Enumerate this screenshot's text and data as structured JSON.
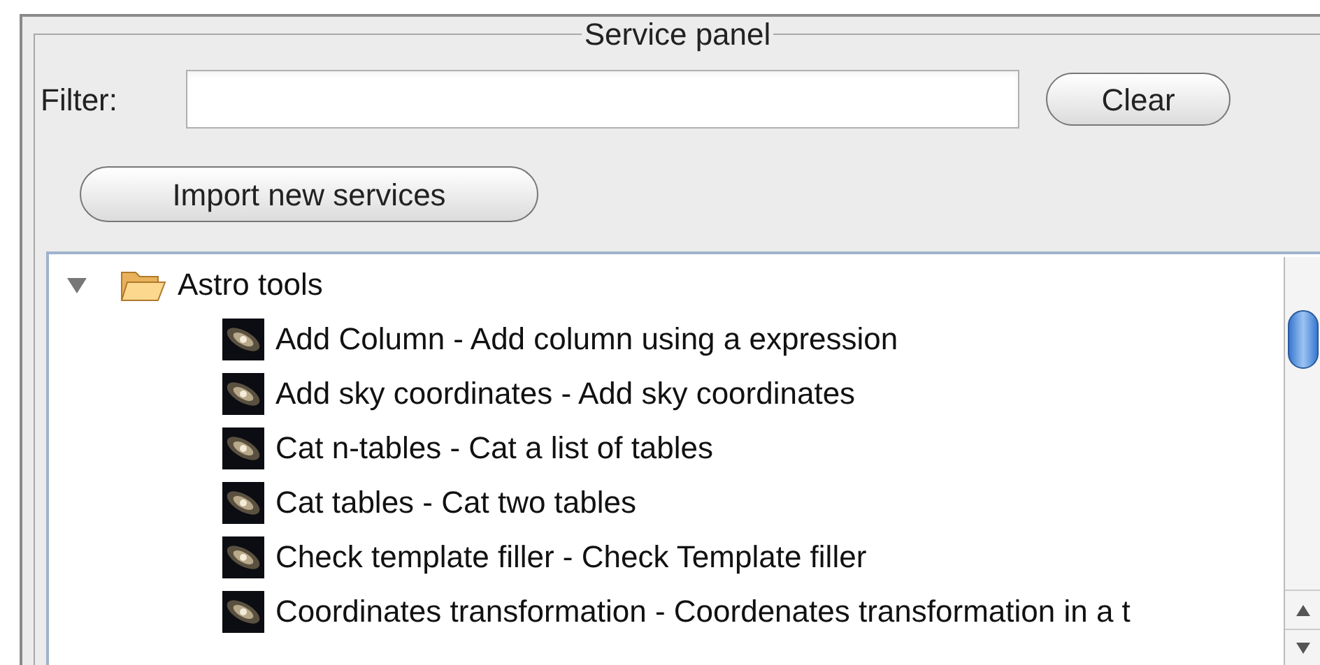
{
  "panel": {
    "title": "Service panel"
  },
  "filter": {
    "label": "Filter:"
  },
  "buttons": [
    {
      "label": "Clear"
    },
    {
      "label": "Import new services"
    }
  ],
  "tree": [
    {
      "label": "Astro tools",
      "expanded": true,
      "children": [
        {
          "label": "Add Column - Add column using a expression"
        },
        {
          "label": "Add sky coordinates - Add sky coordinates"
        },
        {
          "label": "Cat n-tables - Cat a list of tables"
        },
        {
          "label": "Cat tables - Cat two tables"
        },
        {
          "label": "Check template filler - Check Template filler"
        },
        {
          "label": "Coordinates transformation - Coordenates transformation in a t"
        }
      ]
    }
  ]
}
